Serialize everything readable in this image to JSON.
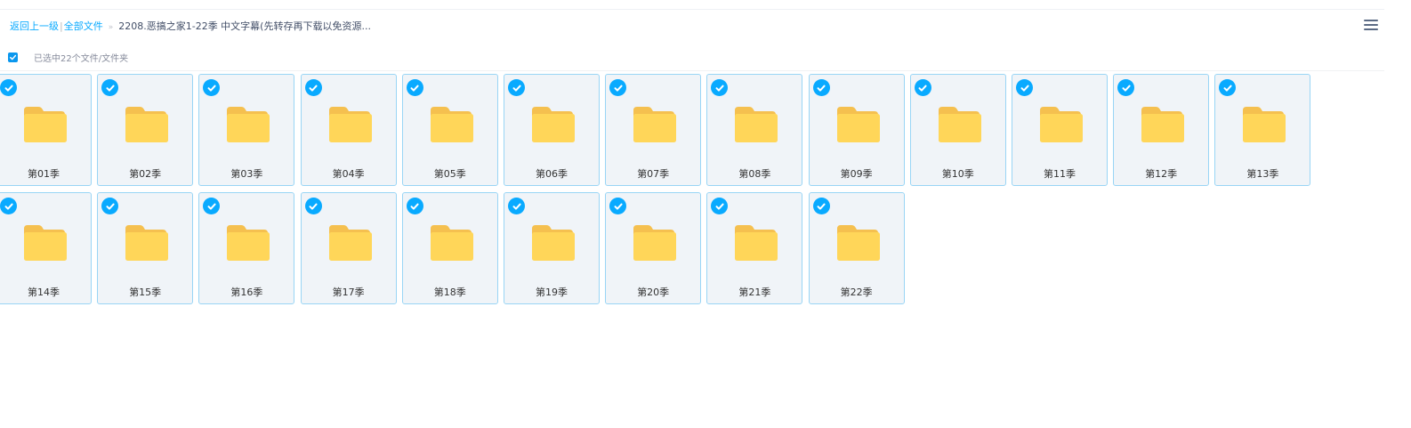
{
  "breadcrumb": {
    "back_label": "返回上一级",
    "separator": "|",
    "all_files_label": "全部文件",
    "arrow": "»",
    "current_folder": "2208.恶搞之家1-22季 中文字幕(先转存再下载以免资源..."
  },
  "menu": {
    "icon": "hamburger-menu-icon"
  },
  "selection": {
    "checked": true,
    "summary": "已选中22个文件/文件夹"
  },
  "colors": {
    "accent": "#09aaff",
    "folder": "#ffd659",
    "folder_tab": "#f5c04f",
    "tile_bg": "#f0f4f8",
    "tile_border": "#99d5f5"
  },
  "folders": [
    {
      "name": "第01季",
      "selected": true
    },
    {
      "name": "第02季",
      "selected": true
    },
    {
      "name": "第03季",
      "selected": true
    },
    {
      "name": "第04季",
      "selected": true
    },
    {
      "name": "第05季",
      "selected": true
    },
    {
      "name": "第06季",
      "selected": true
    },
    {
      "name": "第07季",
      "selected": true
    },
    {
      "name": "第08季",
      "selected": true
    },
    {
      "name": "第09季",
      "selected": true
    },
    {
      "name": "第10季",
      "selected": true
    },
    {
      "name": "第11季",
      "selected": true
    },
    {
      "name": "第12季",
      "selected": true
    },
    {
      "name": "第13季",
      "selected": true
    },
    {
      "name": "第14季",
      "selected": true
    },
    {
      "name": "第15季",
      "selected": true
    },
    {
      "name": "第16季",
      "selected": true
    },
    {
      "name": "第17季",
      "selected": true
    },
    {
      "name": "第18季",
      "selected": true
    },
    {
      "name": "第19季",
      "selected": true
    },
    {
      "name": "第20季",
      "selected": true
    },
    {
      "name": "第21季",
      "selected": true
    },
    {
      "name": "第22季",
      "selected": true
    }
  ]
}
